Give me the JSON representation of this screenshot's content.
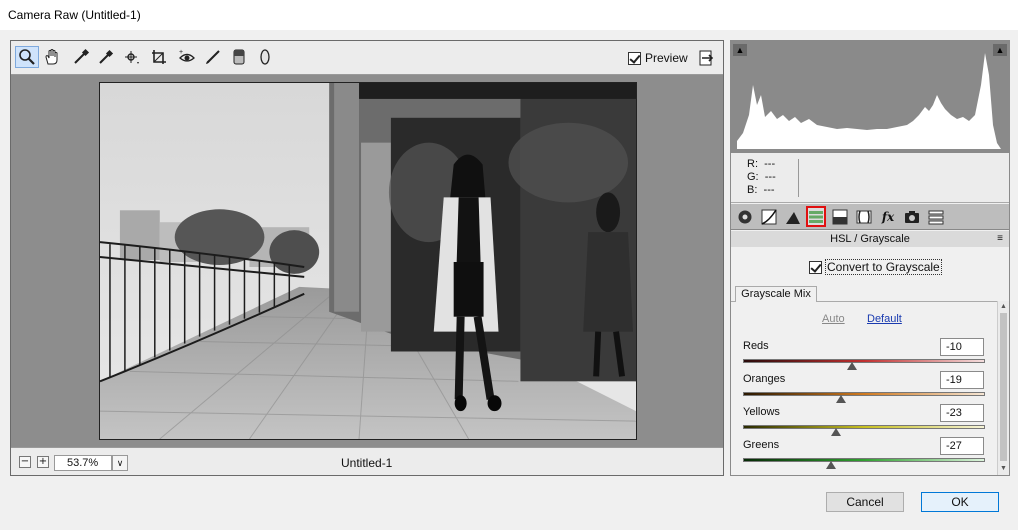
{
  "window": {
    "title": "Camera Raw (Untitled-1)"
  },
  "toolbar": {
    "tools": [
      "zoom-icon",
      "hand-icon",
      "white-balance-icon",
      "color-sampler-icon",
      "targeted-adjustment-icon",
      "crop-straighten-icon",
      "red-eye-icon",
      "adjustment-brush-icon",
      "graduated-filter-icon",
      "radial-filter-icon"
    ],
    "preview_label": "Preview"
  },
  "status": {
    "zoom_value": "53.7%",
    "filename": "Untitled-1",
    "zoom_out": "−",
    "zoom_in": "+"
  },
  "readout": {
    "r_label": "R:",
    "g_label": "G:",
    "b_label": "B:",
    "r_value": "---",
    "g_value": "---",
    "b_value": "---"
  },
  "panel": {
    "section_title": "HSL / Grayscale",
    "convert_label": "Convert to Grayscale",
    "mix_tab": "Grayscale Mix",
    "auto_label": "Auto",
    "default_label": "Default",
    "sliders": [
      {
        "label": "Reds",
        "value": "-10",
        "level": -10
      },
      {
        "label": "Oranges",
        "value": "-19",
        "level": -19
      },
      {
        "label": "Yellows",
        "value": "-23",
        "level": -23
      },
      {
        "label": "Greens",
        "value": "-27",
        "level": -27
      }
    ]
  },
  "footer": {
    "cancel_label": "Cancel",
    "ok_label": "OK"
  },
  "colors": {
    "selected_tab_border": "#e01010",
    "ok_border": "#0078d7",
    "link": "#1a3bb0"
  }
}
